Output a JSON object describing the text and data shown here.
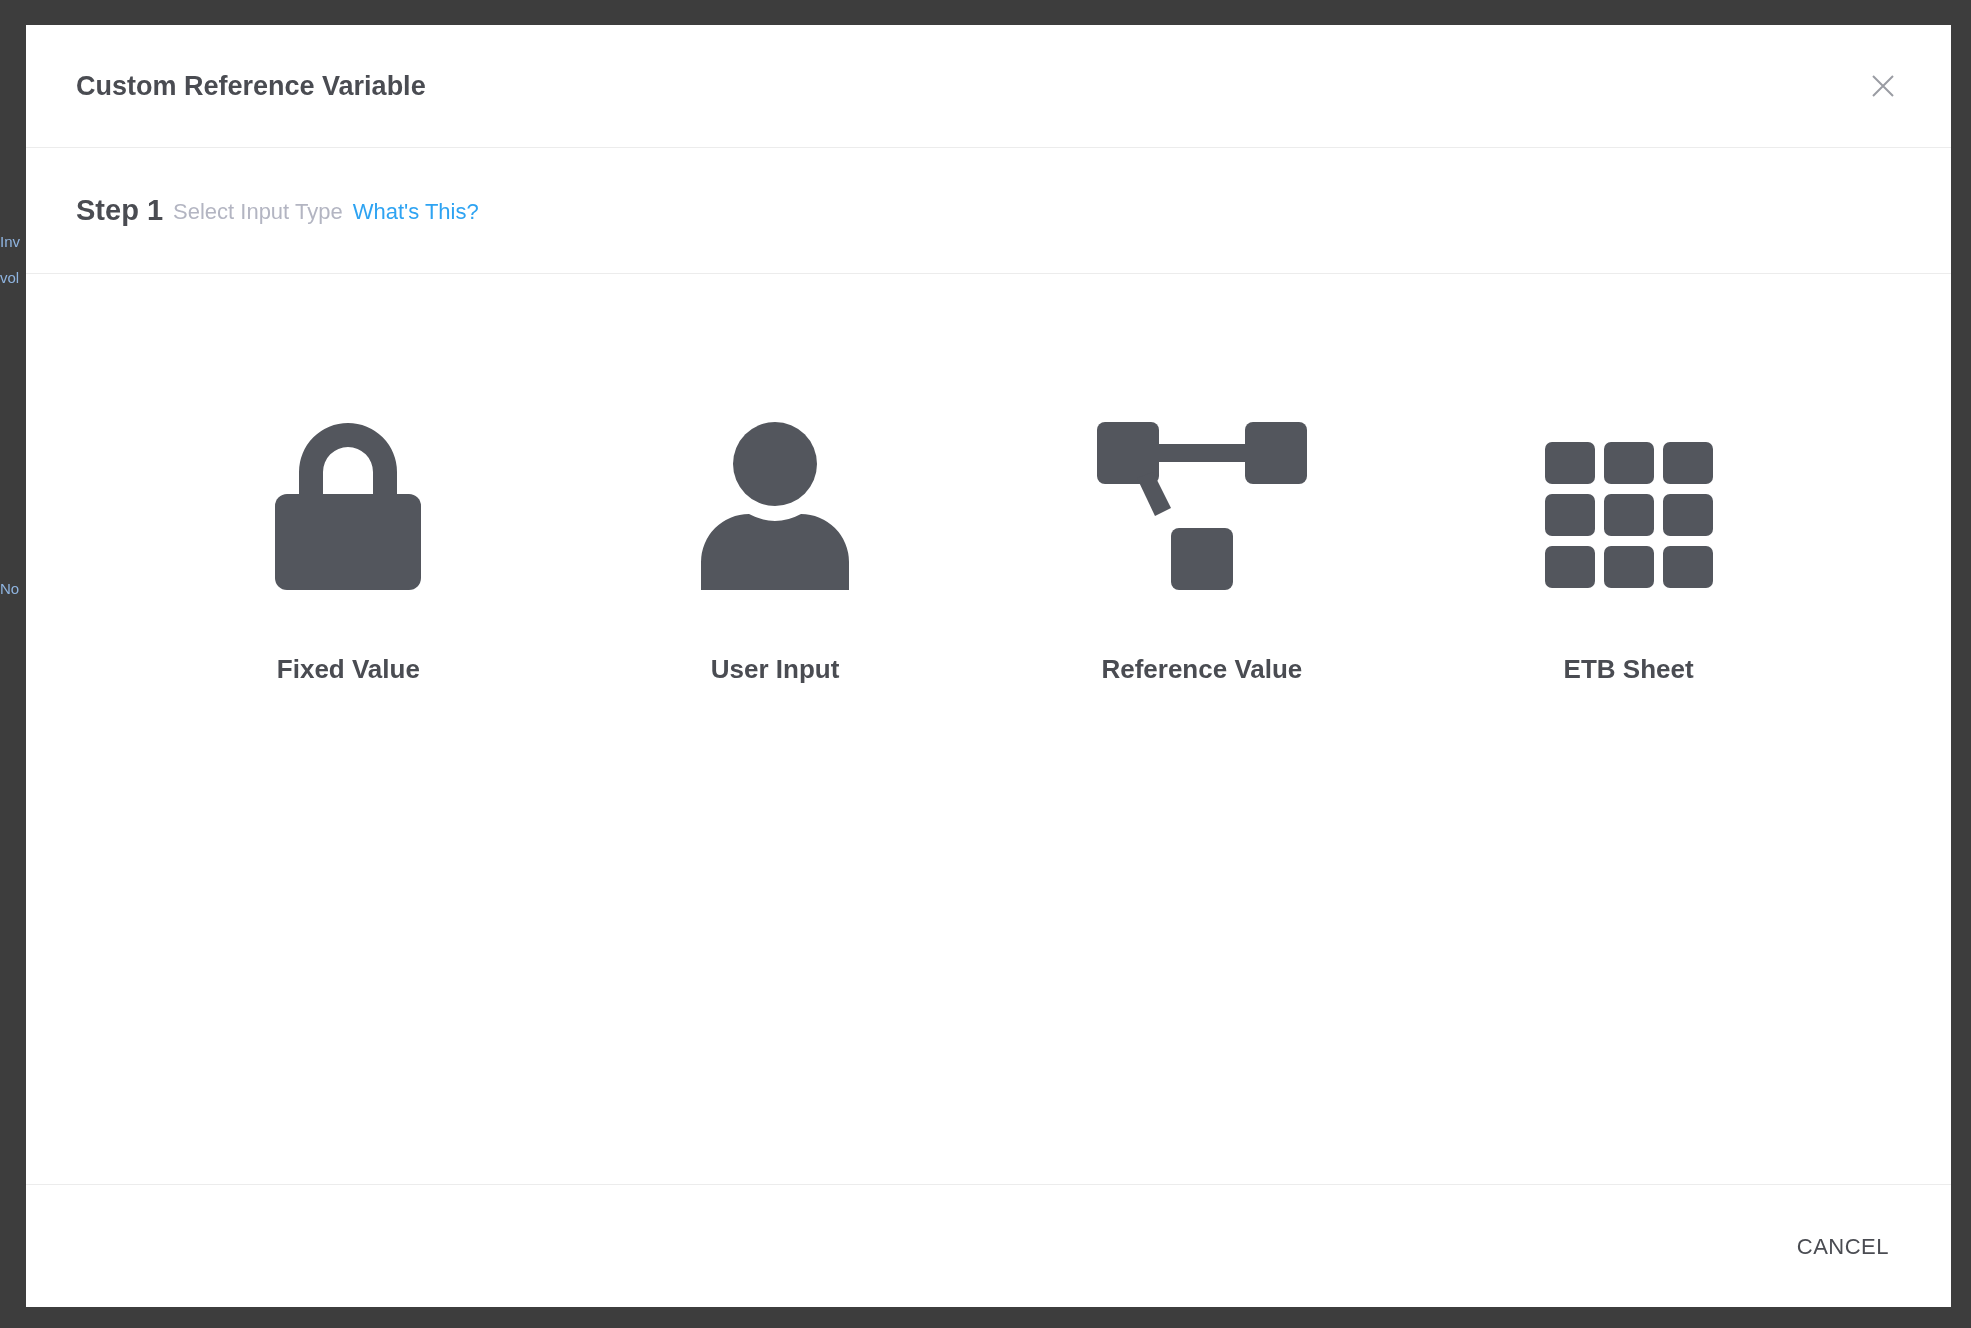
{
  "backdrop": {
    "fragments": [
      "Inv",
      "vol",
      "No"
    ]
  },
  "dialog": {
    "title": "Custom Reference Variable",
    "step": {
      "label": "Step 1",
      "instruction": "Select Input Type",
      "help_link": "What's This?"
    },
    "options": [
      {
        "kind": "lock",
        "label": "Fixed Value"
      },
      {
        "kind": "user",
        "label": "User Input"
      },
      {
        "kind": "tree",
        "label": "Reference Value"
      },
      {
        "kind": "grid",
        "label": "ETB Sheet"
      }
    ],
    "buttons": [
      "CANCEL"
    ]
  }
}
